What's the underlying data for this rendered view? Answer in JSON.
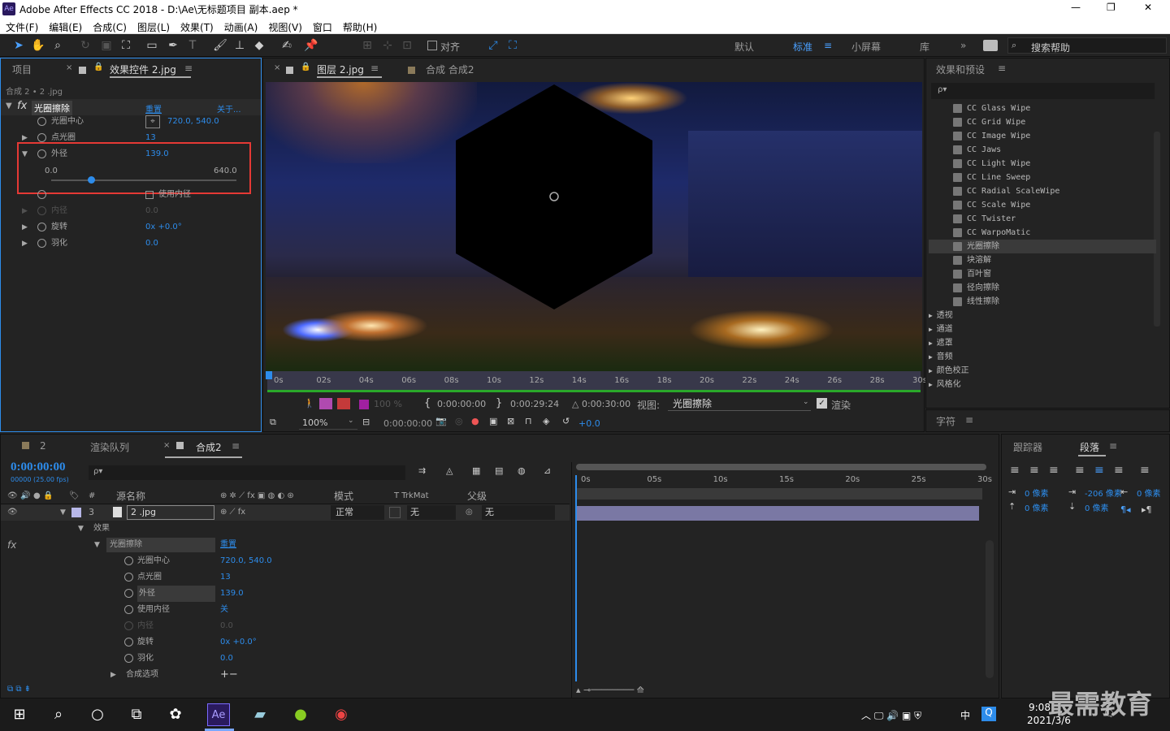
{
  "window": {
    "title": "Adobe After Effects CC 2018 - D:\\Ae\\无标题项目 副本.aep *",
    "logo": "Ae",
    "min": "—",
    "max": "❐",
    "close": "✕"
  },
  "menu": [
    "文件(F)",
    "编辑(E)",
    "合成(C)",
    "图层(L)",
    "效果(T)",
    "动画(A)",
    "视图(V)",
    "窗口",
    "帮助(H)"
  ],
  "toolbar": {
    "align_label": "对齐",
    "workspaces": [
      "默认",
      "标准",
      "小屏幕",
      "库"
    ],
    "search_placeholder": "搜索帮助"
  },
  "left_panel": {
    "tab_project": "项目",
    "tab_effects": "效果控件 2.jpg",
    "breadcrumb": "合成 2 • 2 .jpg",
    "effect_name": "光圈擦除",
    "reset": "重置",
    "about": "关于...",
    "props": [
      {
        "name": "光圈中心",
        "value": "720.0, 540.0"
      },
      {
        "name": "点光圈",
        "value": "13"
      },
      {
        "name": "外径",
        "value": "139.0",
        "min": "0.0",
        "max": "640.0",
        "slider": 0.217
      },
      {
        "name": "使用内径",
        "value": ""
      },
      {
        "name": "内径",
        "value": "0.0"
      },
      {
        "name": "旋转",
        "value": "0x +0.0°"
      },
      {
        "name": "羽化",
        "value": "0.0"
      }
    ]
  },
  "viewer": {
    "tab_layer": "图层 2.jpg",
    "tab_comp": "合成 合成2",
    "ruler": [
      "0s",
      "02s",
      "04s",
      "06s",
      "08s",
      "10s",
      "12s",
      "14s",
      "16s",
      "18s",
      "20s",
      "22s",
      "24s",
      "26s",
      "28s",
      "30s"
    ],
    "tc_in": "0:00:00:00",
    "tc_out": "0:00:29:24",
    "tc_dur": "△ 0:00:30:00",
    "view_label": "视图:",
    "view_value": "光圈擦除",
    "render_label": "渲染",
    "opacity": "100 %",
    "zoom": "100%",
    "tc_current": "0:00:00:00",
    "exposure": "+0.0"
  },
  "effects_panel": {
    "title": "效果和预设",
    "search_placeholder": "ρ▾",
    "items": [
      "CC Glass Wipe",
      "CC Grid Wipe",
      "CC Image Wipe",
      "CC Jaws",
      "CC Light Wipe",
      "CC Line Sweep",
      "CC Radial ScaleWipe",
      "CC Scale Wipe",
      "CC Twister",
      "CC WarpoMatic",
      "光圈擦除",
      "块溶解",
      "百叶窗",
      "径向擦除",
      "线性擦除"
    ],
    "groups": [
      "透视",
      "通道",
      "遮罩",
      "音频",
      "颜色校正",
      "风格化"
    ],
    "selected": "光圈擦除"
  },
  "char_panel": {
    "title": "字符"
  },
  "para_panel": {
    "tab_tracker": "跟踪器",
    "tab_para": "段落",
    "indent_left": "0 像素",
    "indent_first": "-206 像素",
    "indent_right": "0 像素",
    "space_before": "0 像素",
    "space_after": "0 像素"
  },
  "timeline": {
    "tabs": [
      "2",
      "渲染队列",
      "合成2"
    ],
    "timecode": "0:00:00:00",
    "fps": "00000 (25.00 fps)",
    "headers": {
      "source": "源名称",
      "mode": "模式",
      "trk": "T  TrkMat",
      "parent": "父级"
    },
    "layer": {
      "num": "3",
      "name": "2 .jpg",
      "mode": "正常",
      "trkmat": "无",
      "parent": "无"
    },
    "effects_label": "效果",
    "effect_name": "光圈擦除",
    "reset": "重置",
    "props": [
      {
        "name": "光圈中心",
        "value": "720.0, 540.0"
      },
      {
        "name": "点光圈",
        "value": "13"
      },
      {
        "name": "外径",
        "value": "139.0"
      },
      {
        "name": "使用内径",
        "value": "关"
      },
      {
        "name": "内径",
        "value": "0.0"
      },
      {
        "name": "旋转",
        "value": "0x +0.0°"
      },
      {
        "name": "羽化",
        "value": "0.0"
      }
    ],
    "comp_options": "合成选项",
    "comp_opt_value": "+−",
    "ruler": [
      "0s",
      "05s",
      "10s",
      "15s",
      "20s",
      "25s",
      "30s"
    ]
  },
  "taskbar": {
    "time": "9:08",
    "date": "2021/3/6",
    "lang": "中",
    "watermark": "最需教育"
  }
}
